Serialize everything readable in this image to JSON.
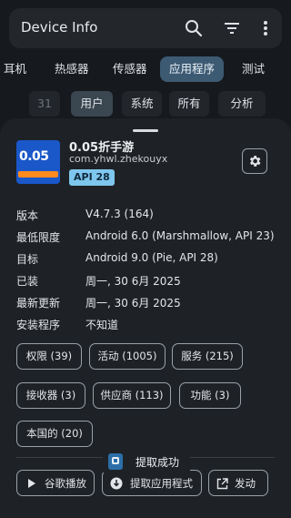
{
  "appbar": {
    "title": "Device Info"
  },
  "tabs": [
    {
      "label": "耳机",
      "active": false
    },
    {
      "label": "热感器",
      "active": false
    },
    {
      "label": "传感器",
      "active": false
    },
    {
      "label": "应用程序",
      "active": true
    },
    {
      "label": "测试",
      "active": false
    }
  ],
  "filters": [
    {
      "label": "31"
    },
    {
      "label": "用户"
    },
    {
      "label": "系统"
    },
    {
      "label": "所有"
    },
    {
      "label": "分析"
    }
  ],
  "app": {
    "name": "0.05折手游",
    "package": "com.yhwl.zhekouyx",
    "api_badge": "API 28",
    "icon_text": "0.05"
  },
  "info": [
    {
      "key": "版本",
      "value": "V4.7.3 (164)"
    },
    {
      "key": "最低限度",
      "value": "Android 6.0 (Marshmallow, API 23)"
    },
    {
      "key": "目标",
      "value": "Android 9.0 (Pie, API 28)"
    },
    {
      "key": "已装",
      "value": "周一, 30 6月 2025"
    },
    {
      "key": "最新更新",
      "value": "周一, 30 6月 2025"
    },
    {
      "key": "安装程序",
      "value": "不知道"
    }
  ],
  "chips": [
    {
      "label": "权限 (39)"
    },
    {
      "label": "活动 (1005)"
    },
    {
      "label": "服务 (215)"
    },
    {
      "label": "接收器 (3)"
    },
    {
      "label": "供应商 (113)"
    },
    {
      "label": "功能 (3)"
    },
    {
      "label": "本国的 (20)"
    }
  ],
  "actions": {
    "play": "谷歌播放",
    "extract": "提取应用程式",
    "launch": "发动"
  },
  "toast": {
    "message": "提取成功"
  },
  "colors": {
    "accent": "#3d5a73",
    "badge": "#7fc6ee",
    "background": "#16191d",
    "sheet": "#1e2226"
  }
}
